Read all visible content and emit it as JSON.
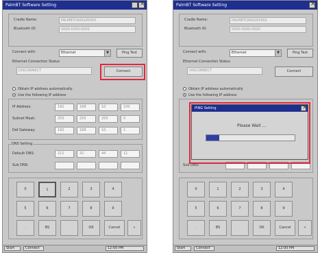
{
  "left": {
    "title": "PalmBT Software Setting",
    "device_name_label": "Cradle Name:",
    "device_name_value": "PALMBTCRADLE0001",
    "bluetooth_id_label": "Bluetooth ID:",
    "bluetooth_id_value": "0000-0000-0000",
    "connect_with_label": "Connect with:",
    "connect_with_value": "Ethernet",
    "ping_test_label": "Ping Test",
    "ethernet_status_label": "Ethernet Connection Status",
    "ethernet_status_value": "DISCONNECT",
    "connect_button": "Connect",
    "obtain_auto_label": "Obtain IP address automatically",
    "use_following_label": "Use the following IP address",
    "ip_label": "IP Address:",
    "subnet_label": "Subnet Mask:",
    "gateway_label": "Def Gateway:",
    "ip": [
      "192",
      "168",
      "10",
      "100"
    ],
    "subnet": [
      "255",
      "255",
      "255",
      "0"
    ],
    "gateway": [
      "192",
      "168",
      "10",
      "1"
    ],
    "dns_group_label": "DNS Setting",
    "default_dns_label": "Default DNS:",
    "sub_dns_label": "Sub DNS:",
    "dns": [
      "211",
      "32",
      "44",
      "11"
    ],
    "sub_dns": [
      "",
      "",
      "",
      ""
    ],
    "keypad": [
      "0",
      "1",
      "2",
      "3",
      "4",
      "5",
      "6",
      "7",
      "8",
      "9",
      ".",
      "BS",
      "OK",
      "Cancel"
    ],
    "taskbar_start": "Start",
    "taskbar_app": "Connect",
    "taskbar_tray": "12:00 PM"
  },
  "right": {
    "title": "PalmBT Software Setting",
    "device_name_label": "Cradle Name:",
    "device_name_value": "PALMBTCRADLE0001",
    "bluetooth_id_label": "Bluetooth ID:",
    "bluetooth_id_value": "0000-0000-0000",
    "connect_with_label": "Connect with:",
    "connect_with_value": "Ethernet",
    "ping_test_label": "Ping Test",
    "ethernet_status_label": "Ethernet Connection Status",
    "ethernet_status_value": "DISCONNECT",
    "connect_button": "Connect",
    "obtain_auto_label": "Obtain IP address automatically",
    "use_following_label": "Use the following IP address",
    "sub_label": "Sub DNS:",
    "dialog_title": "PING Setting",
    "dialog_message": "Please Wait ...",
    "dialog_progress": 0.15,
    "keypad": [
      "0",
      "1",
      "2",
      "3",
      "4",
      "5",
      "6",
      "7",
      "8",
      "9",
      ".",
      "BS",
      "OK",
      "Cancel"
    ],
    "taskbar_start": "Start",
    "taskbar_app": "Connect",
    "taskbar_tray": "12:00 PM"
  }
}
